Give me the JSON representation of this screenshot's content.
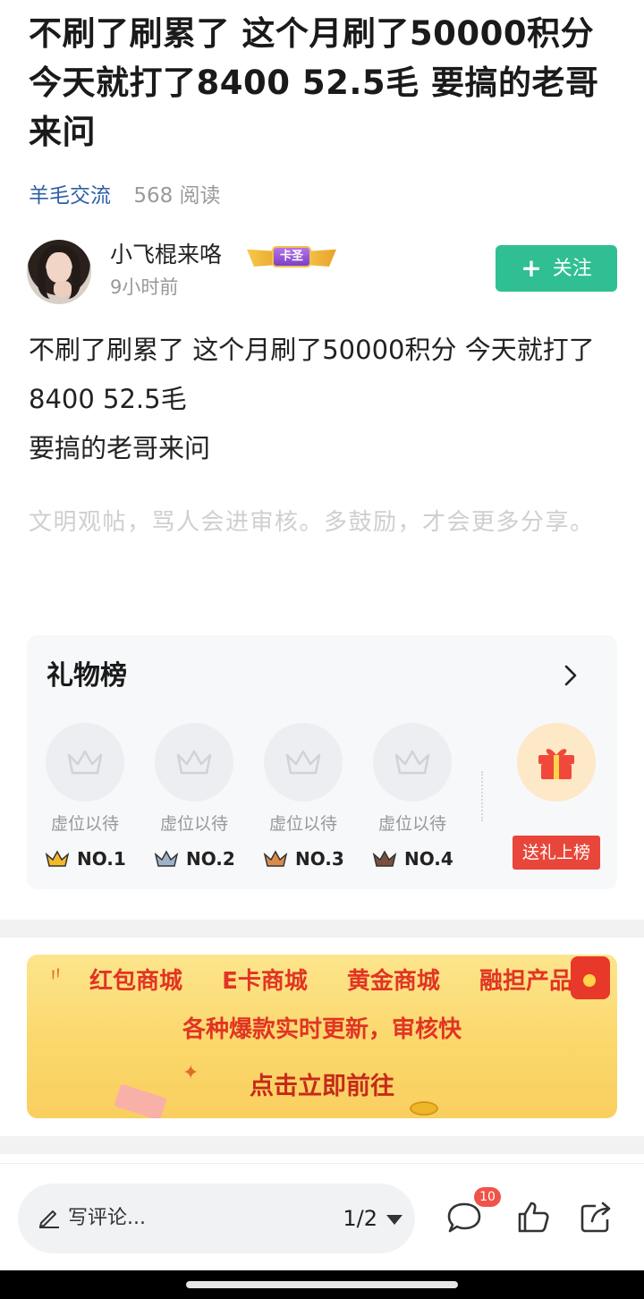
{
  "post": {
    "title": "不刷了刷累了 这个月刷了50000积分 今天就打了8400 52.5毛 要搞的老哥来问",
    "category": "羊毛交流",
    "views": "568 阅读",
    "author": {
      "name": "小飞棍来咯",
      "badge_label": "卡圣",
      "time": "9小时前",
      "follow_label": "关注"
    },
    "body": "不刷了刷累了 这个月刷了50000积分 今天就打了8400 52.5毛\n要搞的老哥来问",
    "hint": "文明观帖，骂人会进审核。多鼓励，才会更多分享。"
  },
  "gift_board": {
    "title": "礼物榜",
    "slots": [
      {
        "empty_label": "虚位以待",
        "rank": "NO.1",
        "crown_color": "#f2b92b"
      },
      {
        "empty_label": "虚位以待",
        "rank": "NO.2",
        "crown_color": "#9fb3c8"
      },
      {
        "empty_label": "虚位以待",
        "rank": "NO.3",
        "crown_color": "#d98c4a"
      },
      {
        "empty_label": "虚位以待",
        "rank": "NO.4",
        "crown_color": "#7a5040"
      }
    ],
    "send_label": "送礼上榜"
  },
  "banner": {
    "items": [
      "红包商城",
      "E卡商城",
      "黄金商城",
      "融担产品"
    ],
    "subtitle": "各种爆款实时更新，审核快",
    "cta": "点击立即前往"
  },
  "bottom_bar": {
    "comment_placeholder": "写评论...",
    "pager": "1/2",
    "comment_count": "10"
  },
  "colors": {
    "accent": "#2fbf93",
    "category": "#2d5fa6",
    "send_button": "#e8463a",
    "banner_text": "#e13524"
  }
}
